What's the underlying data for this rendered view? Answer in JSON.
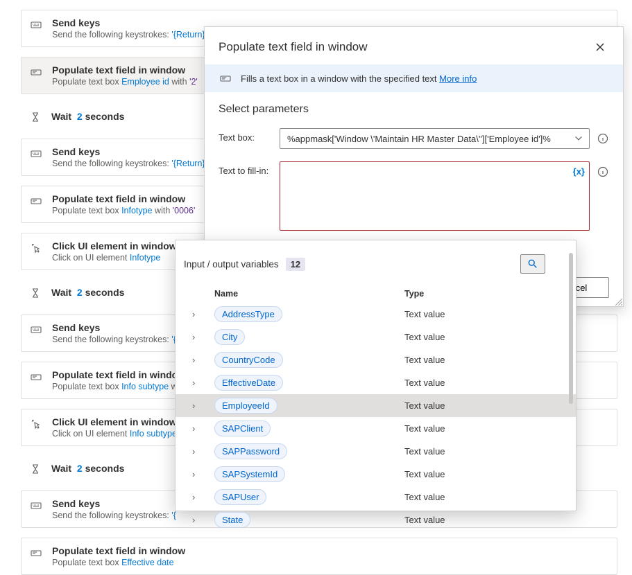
{
  "actions": [
    {
      "kind": "box",
      "icon": "keyboard",
      "title": "Send keys",
      "sub": [
        {
          "t": "Send the following keystrokes: "
        },
        {
          "t": "'{Return}'",
          "c": "tok-var"
        }
      ]
    },
    {
      "kind": "box",
      "icon": "textbox",
      "selected": true,
      "title": "Populate text field in window",
      "sub": [
        {
          "t": "Populate text box "
        },
        {
          "t": "Employee id",
          "c": "tok-var"
        },
        {
          "t": " with "
        },
        {
          "t": "'2'",
          "c": "tok-val"
        }
      ]
    },
    {
      "kind": "wait",
      "icon": "hourglass",
      "title": "Wait",
      "seconds": "2",
      "unit": "seconds"
    },
    {
      "kind": "box",
      "icon": "keyboard",
      "title": "Send keys",
      "sub": [
        {
          "t": "Send the following keystrokes: "
        },
        {
          "t": "'{Return}'",
          "c": "tok-var"
        }
      ]
    },
    {
      "kind": "box",
      "icon": "textbox",
      "title": "Populate text field in window",
      "sub": [
        {
          "t": "Populate text box "
        },
        {
          "t": "Infotype",
          "c": "tok-var"
        },
        {
          "t": " with "
        },
        {
          "t": "'0006'",
          "c": "tok-val"
        }
      ]
    },
    {
      "kind": "box",
      "icon": "click",
      "title": "Click UI element in window",
      "sub": [
        {
          "t": "Click on UI element "
        },
        {
          "t": "Infotype",
          "c": "tok-var"
        }
      ]
    },
    {
      "kind": "wait",
      "icon": "hourglass",
      "title": "Wait",
      "seconds": "2",
      "unit": "seconds"
    },
    {
      "kind": "box",
      "icon": "keyboard",
      "title": "Send keys",
      "sub": [
        {
          "t": "Send the following keystrokes: "
        },
        {
          "t": "'{",
          "c": "tok-var"
        }
      ]
    },
    {
      "kind": "box",
      "icon": "textbox",
      "title": "Populate text field in window",
      "sub": [
        {
          "t": "Populate text box "
        },
        {
          "t": "Info subtype",
          "c": "tok-var"
        },
        {
          "t": " w"
        }
      ]
    },
    {
      "kind": "box",
      "icon": "click",
      "title": "Click UI element in window",
      "sub": [
        {
          "t": "Click on UI element "
        },
        {
          "t": "Info subtype",
          "c": "tok-var"
        }
      ]
    },
    {
      "kind": "wait",
      "icon": "hourglass",
      "title": "Wait",
      "seconds": "2",
      "unit": "seconds"
    },
    {
      "kind": "box",
      "icon": "keyboard",
      "title": "Send keys",
      "sub": [
        {
          "t": "Send the following keystrokes: "
        },
        {
          "t": "'{",
          "c": "tok-var"
        }
      ]
    },
    {
      "kind": "box",
      "icon": "textbox",
      "title": "Populate text field in window",
      "sub": [
        {
          "t": "Populate text box "
        },
        {
          "t": "Effective date",
          "c": "tok-var"
        },
        {
          "t": " "
        }
      ]
    }
  ],
  "dialog": {
    "title": "Populate text field in window",
    "banner_text": "Fills a text box in a window with the specified text ",
    "banner_link": "More info",
    "section_title": "Select parameters",
    "param_textbox_label": "Text box:",
    "param_textbox_value": "%appmask['Window \\'Maintain HR Master Data\\'']['Employee id']%",
    "param_fill_label": "Text to fill-in:",
    "fx_label": "{x}",
    "cancel_label": "cel"
  },
  "variables": {
    "head_title": "Input / output variables",
    "count": "12",
    "col_name": "Name",
    "col_type": "Type",
    "rows": [
      {
        "name": "AddressType",
        "type": "Text value"
      },
      {
        "name": "City",
        "type": "Text value"
      },
      {
        "name": "CountryCode",
        "type": "Text value"
      },
      {
        "name": "EffectiveDate",
        "type": "Text value"
      },
      {
        "name": "EmployeeId",
        "type": "Text value",
        "selected": true
      },
      {
        "name": "SAPClient",
        "type": "Text value"
      },
      {
        "name": "SAPPassword",
        "type": "Text value"
      },
      {
        "name": "SAPSystemId",
        "type": "Text value"
      },
      {
        "name": "SAPUser",
        "type": "Text value"
      },
      {
        "name": "State",
        "type": "Text value"
      }
    ]
  }
}
